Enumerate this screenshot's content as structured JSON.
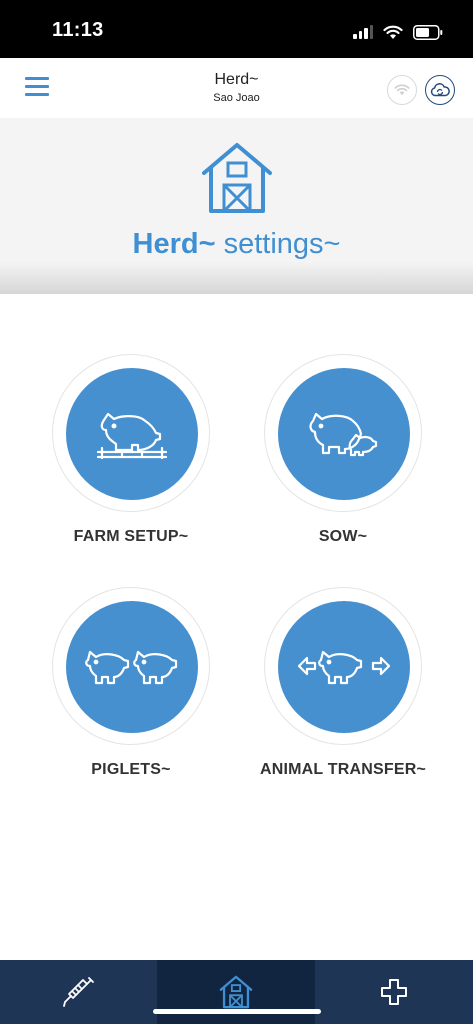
{
  "status_bar": {
    "time": "11:13",
    "icons": [
      "cellular-signal-icon",
      "wifi-icon",
      "battery-icon"
    ]
  },
  "header": {
    "title": "Herd~",
    "subtitle": "Sao Joao",
    "menu_icon": "hamburger-menu-icon",
    "wifi_icon": "wifi-icon",
    "sync_icon": "cloud-sync-icon"
  },
  "hero": {
    "icon": "barn-icon",
    "title_bold": "Herd~",
    "title_light": "settings~"
  },
  "tiles": [
    {
      "label": "FARM SETUP~",
      "icon": "pig-on-pen-icon"
    },
    {
      "label": "SOW~",
      "icon": "sow-with-piglet-icon"
    },
    {
      "label": "PIGLETS~",
      "icon": "two-piglets-icon"
    },
    {
      "label": "ANIMAL TRANSFER~",
      "icon": "pig-transfer-arrows-icon"
    }
  ],
  "bottom_nav": [
    {
      "name": "vaccination",
      "icon": "syringe-icon",
      "active": false
    },
    {
      "name": "herd",
      "icon": "barn-icon",
      "active": true
    },
    {
      "name": "health",
      "icon": "medical-cross-icon",
      "active": false
    }
  ],
  "colors": {
    "primary_blue": "#4690d0",
    "title_blue": "#3f8fd2",
    "nav_background": "#1f3556",
    "nav_active": "#122540",
    "hero_background": "#f4f4f4"
  }
}
